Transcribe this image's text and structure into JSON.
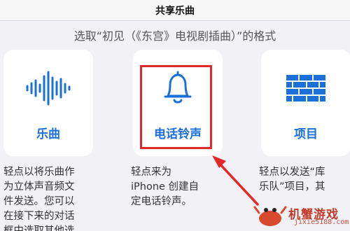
{
  "header": {
    "title": "共享乐曲"
  },
  "prompt": "选取“初见（《东宫》电视剧插曲）”的格式",
  "options": [
    {
      "label": "乐曲",
      "icon": "waveform-icon",
      "desc_lines": [
        "轻点以将乐曲作",
        "为立体声音频文",
        "件发送。您可以",
        "在接下来的对话",
        "框中选取其他选"
      ]
    },
    {
      "label": "电话铃声",
      "icon": "bell-icon",
      "desc_lines": [
        "轻点来为",
        "iPhone 创建自",
        "定电话铃声。"
      ]
    },
    {
      "label": "项目",
      "icon": "brick-wall-icon",
      "desc_lines": [
        "轻点以发送“库",
        "乐队”项目，其"
      ]
    }
  ],
  "watermark": {
    "text": "机蟹游戏",
    "site": "jixie5188.com"
  },
  "colors": {
    "accent": "#1a6fd8",
    "highlight": "#e02a2a",
    "background": "#f2f2f6"
  }
}
